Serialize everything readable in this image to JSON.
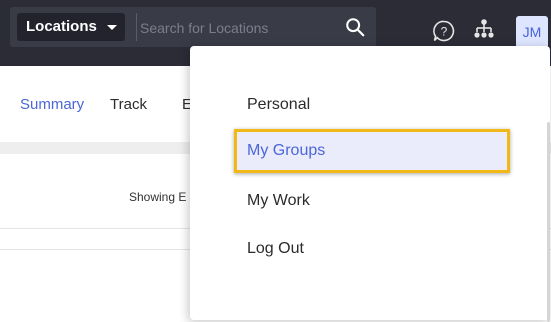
{
  "header": {
    "scope_label": "Locations",
    "search_placeholder": "Search for Locations",
    "avatar_initials": "JM"
  },
  "tabs": [
    {
      "label": "Summary"
    },
    {
      "label": "Track"
    },
    {
      "label": "E"
    }
  ],
  "content": {
    "showing_text": "Showing E"
  },
  "menu": {
    "items": [
      {
        "label": "Personal"
      },
      {
        "label": "My Groups"
      },
      {
        "label": "My Work"
      },
      {
        "label": "Log Out"
      }
    ]
  },
  "colors": {
    "topbar_bg": "#2b2c36",
    "accent": "#4c66d8",
    "highlight_border": "#f2b817"
  }
}
